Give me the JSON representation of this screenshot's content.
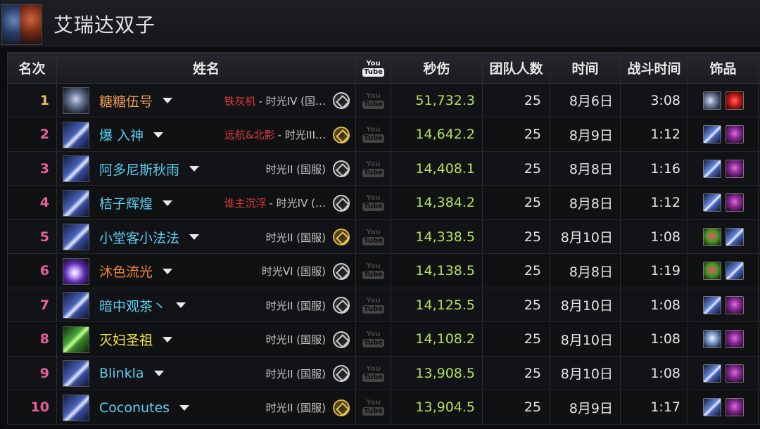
{
  "boss": {
    "name": "艾瑞达双子"
  },
  "columns": {
    "rank": "名次",
    "name": "姓名",
    "video": {
      "line1": "You",
      "line2": "Tube"
    },
    "dps": "秒伤",
    "raid_size": "团队人数",
    "date": "时间",
    "duration": "战斗时间",
    "trinkets": "饰品"
  },
  "rows": [
    {
      "rank": "1",
      "name": "糖糖伍号",
      "name_color": "#e89a55",
      "class_icon": "warrior-icon",
      "guild": "铁灰机",
      "realm": "- 时光IV (国…",
      "faction": "silver",
      "dps": "51,732.3",
      "raid_size": "25",
      "date": "8月6日",
      "duration": "3:08",
      "trinkets": [
        "bomb-trinket-icon",
        "heart-trinket-icon"
      ]
    },
    {
      "rank": "2",
      "name": "爆 ⼊神",
      "name_color": "#5ecdf0",
      "class_icon": "mage-icon",
      "guild": "远航&北影",
      "realm": "- 时光III…",
      "faction": "gold",
      "dps": "14,642.2",
      "raid_size": "25",
      "date": "8月9日",
      "duration": "1:12",
      "trinkets": [
        "blade-trinket-icon",
        "skull-trinket-icon"
      ]
    },
    {
      "rank": "3",
      "name": "阿多尼斯秋雨",
      "name_color": "#5ecdf0",
      "class_icon": "mage-icon",
      "guild": "",
      "realm": "时光II (国服)",
      "faction": "silver",
      "dps": "14,408.1",
      "raid_size": "25",
      "date": "8月8日",
      "duration": "1:16",
      "trinkets": [
        "blade-trinket-icon",
        "skull-trinket-icon"
      ]
    },
    {
      "rank": "4",
      "name": "桔子辉煌",
      "name_color": "#5ecdf0",
      "class_icon": "mage-icon",
      "guild": "谁主沉浮",
      "realm": "- 时光IV (…",
      "faction": "silver",
      "dps": "14,384.2",
      "raid_size": "25",
      "date": "8月8日",
      "duration": "1:12",
      "trinkets": [
        "blade-trinket-icon",
        "skull-trinket-icon"
      ]
    },
    {
      "rank": "5",
      "name": "小堂客小法法",
      "name_color": "#5ecdf0",
      "class_icon": "mage-icon",
      "guild": "",
      "realm": "时光II (国服)",
      "faction": "gold",
      "dps": "14,338.5",
      "raid_size": "25",
      "date": "8月10日",
      "duration": "1:08",
      "trinkets": [
        "rose-trinket-icon",
        "blade-trinket-icon"
      ]
    },
    {
      "rank": "6",
      "name": "沐色流光",
      "name_color": "#f2853a",
      "class_icon": "arcane-icon",
      "guild": "",
      "realm": "时光VI (国服)",
      "faction": "silver",
      "dps": "14,138.5",
      "raid_size": "25",
      "date": "8月8日",
      "duration": "1:19",
      "trinkets": [
        "rose-trinket-icon",
        "blade-trinket-icon"
      ]
    },
    {
      "rank": "7",
      "name": "暗中观茶丶",
      "name_color": "#5ecdf0",
      "class_icon": "mage-icon",
      "guild": "",
      "realm": "时光II (国服)",
      "faction": "silver",
      "dps": "14,125.5",
      "raid_size": "25",
      "date": "8月10日",
      "duration": "1:08",
      "trinkets": [
        "blade-trinket-icon",
        "skull-trinket-icon"
      ]
    },
    {
      "rank": "8",
      "name": "灭妇圣祖",
      "name_color": "#f0e048",
      "class_icon": "druid-icon",
      "guild": "",
      "realm": "时光II (国服)",
      "faction": "silver",
      "dps": "14,108.2",
      "raid_size": "25",
      "date": "8月10日",
      "duration": "1:08",
      "trinkets": [
        "ghost-trinket-icon",
        "skull-trinket-icon"
      ]
    },
    {
      "rank": "9",
      "name": "Blinkla",
      "name_color": "#5ecdf0",
      "class_icon": "mage-icon",
      "guild": "",
      "realm": "时光II (国服)",
      "faction": "silver",
      "dps": "13,908.5",
      "raid_size": "25",
      "date": "8月10日",
      "duration": "1:08",
      "trinkets": [
        "blade-trinket-icon",
        "skull-trinket-icon"
      ]
    },
    {
      "rank": "10",
      "name": "Coconutes",
      "name_color": "#5ecdf0",
      "class_icon": "mage-icon",
      "guild": "",
      "realm": "时光II (国服)",
      "faction": "gold",
      "dps": "13,904.5",
      "raid_size": "25",
      "date": "8月9日",
      "duration": "1:17",
      "trinkets": [
        "blade-trinket-icon",
        "skull-trinket-icon"
      ]
    }
  ]
}
